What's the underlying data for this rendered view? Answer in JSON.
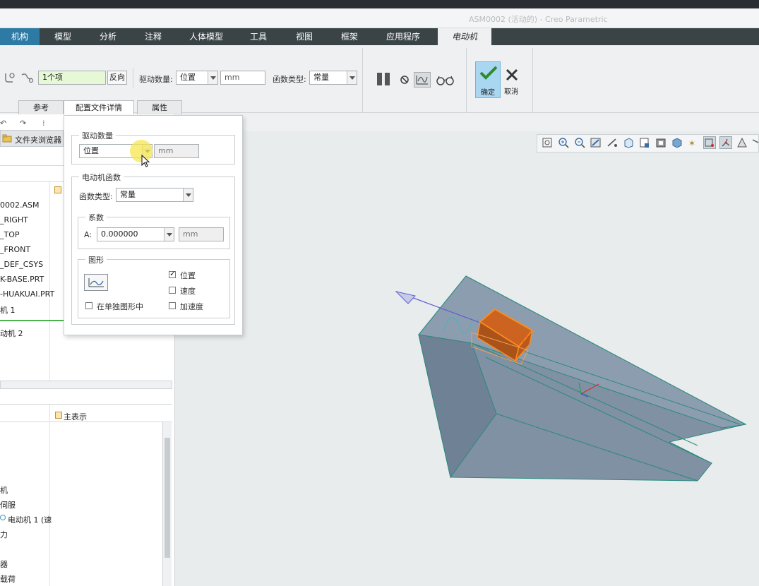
{
  "window": {
    "title": "ASM0002 (活动的) - Creo Parametric"
  },
  "tabs": [
    {
      "label": "机构"
    },
    {
      "label": "模型"
    },
    {
      "label": "分析"
    },
    {
      "label": "注释"
    },
    {
      "label": "人体模型"
    },
    {
      "label": "工具"
    },
    {
      "label": "视图"
    },
    {
      "label": "框架"
    },
    {
      "label": "应用程序"
    },
    {
      "label": "电动机"
    }
  ],
  "ribbon": {
    "reference_field": "1个项",
    "reverse_button": "反向",
    "drive_qty_label": "驱动数量:",
    "drive_qty_value": "位置",
    "drive_unit": "mm",
    "func_type_label": "函数类型:",
    "func_type_value": "常量",
    "ok_label": "确定",
    "cancel_label": "取消"
  },
  "subtabs": [
    {
      "label": "参考"
    },
    {
      "label": "配置文件详情"
    },
    {
      "label": "属性"
    }
  ],
  "popup": {
    "drive_group_title": "驱动数量",
    "drive_value": "位置",
    "drive_unit": "mm",
    "motor_func_title": "电动机函数",
    "func_type_label": "函数类型:",
    "func_type_value": "常量",
    "coef_title": "系数",
    "coef_label": "A:",
    "coef_value": "0.000000",
    "coef_unit": "mm",
    "graph_title": "图形",
    "chk_position": "位置",
    "chk_velocity": "速度",
    "chk_accel": "加速度",
    "chk_separate": "在单独图形中"
  },
  "left": {
    "browser_tab": "文件夹浏览器",
    "tree_items": [
      "0002.ASM",
      "_RIGHT",
      "_TOP",
      "_FRONT",
      "_DEF_CSYS",
      "K-BASE.PRT",
      "-HUAKUAI.PRT",
      "机 1",
      "动机 2"
    ],
    "main_rep": "主表示",
    "lower_items": [
      "机",
      "伺服",
      "电动机 1 (速",
      "力",
      "器",
      "载荷"
    ]
  }
}
